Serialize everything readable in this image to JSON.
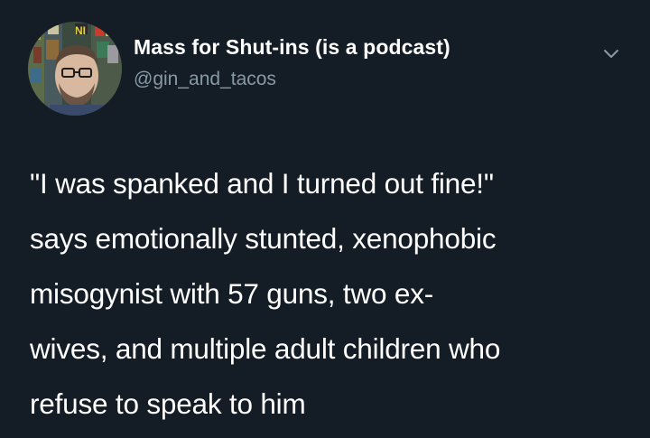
{
  "tweet": {
    "author": {
      "display_name": "Mass for Shut-ins (is a podcast)",
      "handle": "@gin_and_tacos",
      "avatar_icon": "profile-photo"
    },
    "more_icon": "chevron-down-icon",
    "text_lines": [
      "\"I was spanked and I turned out fine!\"",
      "says emotionally stunted, xenophobic",
      "misogynist with 57 guns, two ex-",
      "wives, and multiple adult children who",
      "refuse to speak to him"
    ]
  },
  "colors": {
    "background": "#141d26",
    "text": "#ffffff",
    "secondary_text": "#8899a6"
  }
}
